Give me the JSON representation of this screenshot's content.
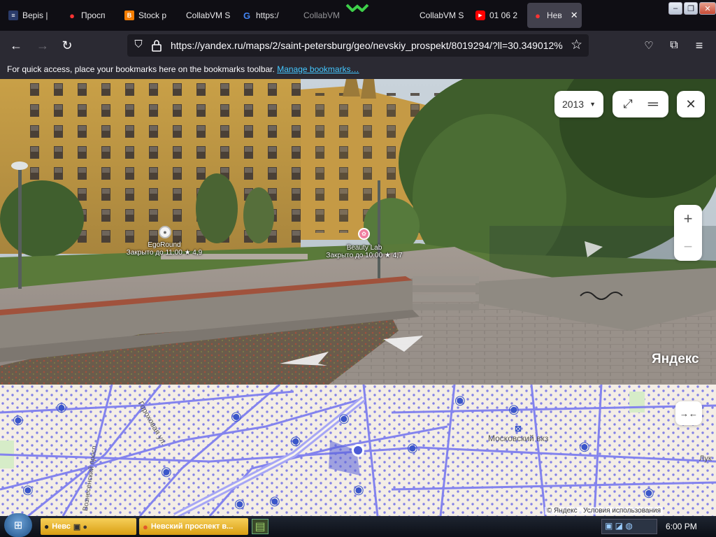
{
  "tabs": [
    {
      "label": "Bepis | ",
      "icon": "site-icon"
    },
    {
      "label": "Просп",
      "icon": "map-pin-icon"
    },
    {
      "label": "Stock p",
      "icon": "blogger-icon"
    },
    {
      "label": "CollabVM S",
      "icon": "collabvm-icon"
    },
    {
      "label": "https:/",
      "icon": "google-icon"
    },
    {
      "label": "CollabVM",
      "icon": "collabvm-icon"
    },
    {
      "label": "CollabVM S",
      "icon": "collabvm-icon"
    },
    {
      "label": "01 06 2",
      "icon": "youtube-icon"
    },
    {
      "label": "Нев",
      "icon": "map-pin-icon",
      "active": true
    }
  ],
  "window_controls": {
    "minimize": "–",
    "restore": "❐",
    "close": "✕"
  },
  "nav": {
    "url": "https://yandex.ru/maps/2/saint-petersburg/geo/nevskiy_prospekt/8019294/?ll=30.349012%"
  },
  "bookmarks_bar": {
    "text": "For quick access, place your bookmarks here on the bookmarks toolbar.",
    "link": "Manage bookmarks…"
  },
  "panorama": {
    "year": "2013",
    "poi": [
      {
        "name": "EgoRound",
        "status": "Закрыто до 11:00",
        "rating": "★ 4,9"
      },
      {
        "name": "Beauty Lab",
        "status": "Закрыто до 10:00",
        "rating": "★ 4,7"
      }
    ],
    "watermark": "Яндекс",
    "zoom_in": "+",
    "zoom_out": "−"
  },
  "map": {
    "street_labels": [
      "Гороховая ул.",
      "Вознесенский просп."
    ],
    "station_label": "Московский вкз",
    "edge_label": "Лук",
    "footer_copyright": "© Яндекс",
    "footer_terms": "Условия использования"
  },
  "taskbar": {
    "buttons": [
      {
        "label": "Невс"
      },
      {
        "label": "Невский проспект в..."
      }
    ],
    "clock": "6:00 PM"
  },
  "colors": {
    "tab_bg": "#0f0e14",
    "toolbar_bg": "#2b2a33",
    "url_bg": "#1c1b22",
    "link": "#44c7ff",
    "map_street": "#7f7ff0",
    "map_pin": "#3a56c9",
    "taskbar_button": "#f0c030"
  }
}
